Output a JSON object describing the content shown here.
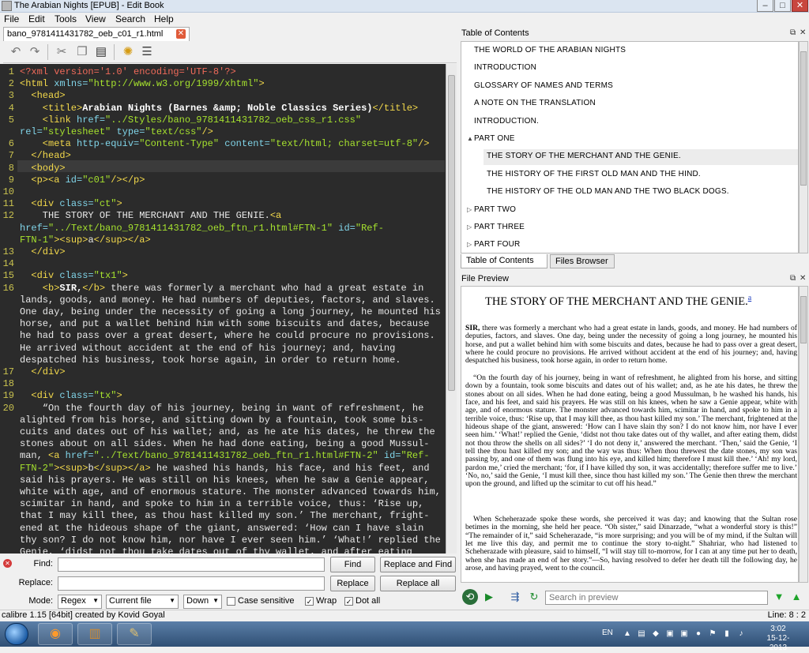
{
  "window": {
    "title": "The Arabian Nights [EPUB] - Edit Book"
  },
  "menu": [
    "File",
    "Edit",
    "Tools",
    "View",
    "Search",
    "Help"
  ],
  "editor": {
    "tab_label": "bano_9781411431782_oeb_c01_r1.html",
    "current_line": 8,
    "lines": [
      {
        "n": "1",
        "parts": [
          [
            "pi",
            "<?xml version='1.0' encoding='UTF-8'?>"
          ]
        ]
      },
      {
        "n": "2",
        "parts": [
          [
            "tag",
            "<html "
          ],
          [
            "at",
            "xmlns="
          ],
          [
            "sv",
            "\"http://www.w3.org/1999/xhtml\""
          ],
          [
            "tag",
            ">"
          ]
        ]
      },
      {
        "n": "3",
        "parts": [
          [
            "tag",
            "  <head>"
          ]
        ]
      },
      {
        "n": "4",
        "parts": [
          [
            "tag",
            "    <title>"
          ],
          [
            "bo",
            "Arabian Nights (Barnes &amp; Noble Classics Series)"
          ],
          [
            "tag",
            "</title>"
          ]
        ]
      },
      {
        "n": "5",
        "parts": [
          [
            "tag",
            "    <link "
          ],
          [
            "at",
            "href="
          ],
          [
            "sv",
            "\"../Styles/bano_9781411431782_oeb_css_r1.css\""
          ]
        ]
      },
      {
        "n": "",
        "parts": [
          [
            "at",
            "rel="
          ],
          [
            "sv",
            "\"stylesheet\" "
          ],
          [
            "at",
            "type="
          ],
          [
            "sv",
            "\"text/css\""
          ],
          [
            "tag",
            "/>"
          ]
        ]
      },
      {
        "n": "6",
        "parts": [
          [
            "tag",
            "    <meta "
          ],
          [
            "at",
            "http-equiv="
          ],
          [
            "sv",
            "\"Content-Type\" "
          ],
          [
            "at",
            "content="
          ],
          [
            "sv",
            "\"text/html; charset=utf-8\""
          ],
          [
            "tag",
            "/>"
          ]
        ]
      },
      {
        "n": "7",
        "parts": [
          [
            "tag",
            "  </head>"
          ]
        ]
      },
      {
        "n": "8",
        "parts": [
          [
            "tag",
            "  <body>"
          ]
        ]
      },
      {
        "n": "9",
        "parts": [
          [
            "tag",
            "  <p><a "
          ],
          [
            "at",
            "id="
          ],
          [
            "sv",
            "\"c01\""
          ],
          [
            "tag",
            "/></p>"
          ]
        ]
      },
      {
        "n": "10",
        "parts": [
          [
            "t",
            ""
          ]
        ]
      },
      {
        "n": "11",
        "parts": [
          [
            "tag",
            "  <div "
          ],
          [
            "at",
            "class="
          ],
          [
            "sv",
            "\"ct\""
          ],
          [
            "tag",
            ">"
          ]
        ]
      },
      {
        "n": "12",
        "parts": [
          [
            "t",
            "    THE STORY OF THE MERCHANT AND THE GENIE."
          ],
          [
            "tag",
            "<a"
          ]
        ]
      },
      {
        "n": "",
        "parts": [
          [
            "at",
            "href="
          ],
          [
            "sv",
            "\"../Text/bano_9781411431782_oeb_ftn_r1.html#FTN-1\" "
          ],
          [
            "at",
            "id="
          ],
          [
            "sv",
            "\"Ref-"
          ]
        ]
      },
      {
        "n": "",
        "parts": [
          [
            "sv",
            "FTN-1\""
          ],
          [
            "tag",
            "><sup>"
          ],
          [
            "t",
            "a"
          ],
          [
            "tag",
            "</sup></a>"
          ]
        ]
      },
      {
        "n": "13",
        "parts": [
          [
            "tag",
            "  </div>"
          ]
        ]
      },
      {
        "n": "14",
        "parts": [
          [
            "t",
            ""
          ]
        ]
      },
      {
        "n": "15",
        "parts": [
          [
            "tag",
            "  <div "
          ],
          [
            "at",
            "class="
          ],
          [
            "sv",
            "\"tx1\""
          ],
          [
            "tag",
            ">"
          ]
        ]
      },
      {
        "n": "16",
        "parts": [
          [
            "tag",
            "    <b>"
          ],
          [
            "bo",
            "SIR,"
          ],
          [
            "tag",
            "</b>"
          ],
          [
            "t",
            " there was formerly a merchant who had a great estate in"
          ]
        ]
      },
      {
        "n": "",
        "parts": [
          [
            "t",
            "lands, goods, and money. He had numbers of deputies, factors, and slaves."
          ]
        ]
      },
      {
        "n": "",
        "parts": [
          [
            "t",
            "One day, being under the necessity of going a long journey, he mounted his"
          ]
        ]
      },
      {
        "n": "",
        "parts": [
          [
            "t",
            "horse, and put a wallet behind him with some biscuits and dates, because"
          ]
        ]
      },
      {
        "n": "",
        "parts": [
          [
            "t",
            "he had to pass over a great desert, where he could procure no provisions."
          ]
        ]
      },
      {
        "n": "",
        "parts": [
          [
            "t",
            "He arrived without accident at the end of his journey; and, having"
          ]
        ]
      },
      {
        "n": "",
        "parts": [
          [
            "t",
            "despatched his business, took horse again, in order to return home."
          ]
        ]
      },
      {
        "n": "17",
        "parts": [
          [
            "tag",
            "  </div>"
          ]
        ]
      },
      {
        "n": "18",
        "parts": [
          [
            "t",
            ""
          ]
        ]
      },
      {
        "n": "19",
        "parts": [
          [
            "tag",
            "  <div "
          ],
          [
            "at",
            "class="
          ],
          [
            "sv",
            "\"tx\""
          ],
          [
            "tag",
            ">"
          ]
        ]
      },
      {
        "n": "20",
        "parts": [
          [
            "t",
            "    “On the fourth day of his journey, being in want of refreshment, he"
          ]
        ]
      },
      {
        "n": "",
        "parts": [
          [
            "t",
            "alighted from his horse, and sitting down by a fountain, took some bis-"
          ]
        ]
      },
      {
        "n": "",
        "parts": [
          [
            "t",
            "cuits and dates out of his wallet; and, as he ate his dates, he threw the"
          ]
        ]
      },
      {
        "n": "",
        "parts": [
          [
            "t",
            "stones about on all sides. When he had done eating, being a good Mussul-"
          ]
        ]
      },
      {
        "n": "",
        "parts": [
          [
            "t",
            "man, "
          ],
          [
            "tag",
            "<a "
          ],
          [
            "at",
            "href="
          ],
          [
            "sv",
            "\"../Text/bano_9781411431782_oeb_ftn_r1.html#FTN-2\" "
          ],
          [
            "at",
            "id="
          ],
          [
            "sv",
            "\"Ref-"
          ]
        ]
      },
      {
        "n": "",
        "parts": [
          [
            "sv",
            "FTN-2\""
          ],
          [
            "tag",
            "><sup>"
          ],
          [
            "t",
            "b"
          ],
          [
            "tag",
            "</sup></a>"
          ],
          [
            "t",
            " he washed his hands, his face, and his feet, and"
          ]
        ]
      },
      {
        "n": "",
        "parts": [
          [
            "t",
            "said his prayers. He was still on his knees, when he saw a Genie appear,"
          ]
        ]
      },
      {
        "n": "",
        "parts": [
          [
            "t",
            "white with age, and of enormous stature. The monster advanced towards him,"
          ]
        ]
      },
      {
        "n": "",
        "parts": [
          [
            "t",
            "scimitar in hand, and spoke to him in a terrible voice, thus: ‘Rise up,"
          ]
        ]
      },
      {
        "n": "",
        "parts": [
          [
            "t",
            "that I may kill thee, as thou hast killed my son.’ The merchant, fright-"
          ]
        ]
      },
      {
        "n": "",
        "parts": [
          [
            "t",
            "ened at the hideous shape of the giant, answered: ‘How can I have slain"
          ]
        ]
      },
      {
        "n": "",
        "parts": [
          [
            "t",
            "thy son? I do not know him, nor have I ever seen him.’ ‘What!’ replied the"
          ]
        ]
      },
      {
        "n": "",
        "parts": [
          [
            "t",
            "Genie, ‘didst not thou take dates out of thy wallet, and after eating"
          ]
        ]
      }
    ]
  },
  "find": {
    "find_label": "Find:",
    "replace_label": "Replace:",
    "mode_label": "Mode:",
    "find_value": "",
    "replace_value": "",
    "find_btn": "Find",
    "replace_and_find_btn": "Replace and Find",
    "replace_btn": "Replace",
    "replace_all_btn": "Replace all",
    "mode_value": "Regex",
    "scope_value": "Current file",
    "direction_value": "Down",
    "case_label": "Case sensitive",
    "wrap_label": "Wrap",
    "dotall_label": "Dot all",
    "case_checked": false,
    "wrap_checked": true,
    "dotall_checked": true
  },
  "status": {
    "left": "calibre 1.15 [64bit] created by Kovid Goyal",
    "right": "Line: 8 : 2"
  },
  "toc": {
    "title": "Table of Contents",
    "items": [
      {
        "label": "THE WORLD OF THE ARABIAN NIGHTS",
        "level": 0,
        "arrow": ""
      },
      {
        "label": "INTRODUCTION",
        "level": 0,
        "arrow": ""
      },
      {
        "label": "GLOSSARY OF NAMES AND TERMS",
        "level": 0,
        "arrow": ""
      },
      {
        "label": "A NOTE ON THE TRANSLATION",
        "level": 0,
        "arrow": ""
      },
      {
        "label": "INTRODUCTION.",
        "level": 0,
        "arrow": ""
      },
      {
        "label": "PART ONE",
        "level": 0,
        "arrow": "▲"
      },
      {
        "label": "THE STORY OF THE MERCHANT AND THE GENIE.",
        "level": 1,
        "arrow": "",
        "selected": true
      },
      {
        "label": "THE HISTORY OF THE FIRST OLD MAN AND THE HIND.",
        "level": 1,
        "arrow": ""
      },
      {
        "label": "THE HISTORY OF THE OLD MAN AND THE TWO BLACK DOGS.",
        "level": 1,
        "arrow": ""
      },
      {
        "label": "PART TWO",
        "level": 0,
        "arrow": "▷"
      },
      {
        "label": "PART THREE",
        "level": 0,
        "arrow": "▷"
      },
      {
        "label": "PART FOUR",
        "level": 0,
        "arrow": "▷"
      }
    ],
    "tabs": [
      "Table of Contents",
      "Files Browser"
    ]
  },
  "preview": {
    "title": "File Preview",
    "heading": "THE STORY OF THE MERCHANT AND THE GENIE.",
    "heading_sup": "a",
    "search_placeholder": "Search in preview",
    "para1_bold": "SIR,",
    "para1": " there was formerly a merchant who had a great estate in lands, goods, and money. He had numbers of deputies, factors, and slaves. One day, being under the necessity of going a long journey, he mounted his horse, and put a wallet behind him with some biscuits and dates, because he had to pass over a great desert, where he could procure no provisions. He arrived without accident at the end of his journey; and, having despatched his business, took horse again, in order to return home.",
    "para2": "“On the fourth day of his journey, being in want of refreshment, he alighted from his horse, and sitting down by a fountain, took some biscuits and dates out of his wallet; and, as he ate his dates, he threw the stones about on all sides. When he had done eating, being a good Mussulman, b he washed his hands, his face, and his feet, and said his prayers. He was still on his knees, when he saw a Genie appear, white with age, and of enormous stature. The monster advanced towards him, scimitar in hand, and spoke to him in a terrible voice, thus: ‘Rise up, that I may kill thee, as thou hast killed my son.’ The merchant, frightened at the hideous shape of the giant, answered: ‘How can I have slain thy son? I do not know him, nor have I ever seen him.’ ‘What!’ replied the Genie, ‘didst not thou take dates out of thy wallet, and after eating them, didst not thou throw the shells on all sides?’ ‘I do not deny it,’ answered the merchant. ‘Then,’ said the Genie, ‘I tell thee thou hast killed my son; and the way was thus: When thou threwest the date stones, my son was passing by, and one of them was flung into his eye, and killed him; therefore I must kill thee.’ ‘Ah! my lord, pardon me,’ cried the merchant; ‘for, if I have killed thy son, it was accidentally; therefore suffer me to live.’ ‘No, no,’ said the Genie, ‘I must kill thee, since thou hast killed my son.’ The Genie then threw the merchant upon the ground, and lifted up the scimitar to cut off his head.”",
    "para3": "When Scheherazade spoke these words, she perceived it was day; and knowing that the Sultan rose betimes in the morning, she held her peace. “Oh sister,” said Dinarzade, “what a wonderful story is this!” “The remainder of it,” said Scheherazade, “is more surprising; and you will be of my mind, if the Sultan will let me live this day, and permit me to continue the story to-night.” Shahriar, who had listened to Scheherazade with pleasure, said to himself, “I will stay till to-morrow, for I can at any time put her to death, when she has made an end of her story.”—So, having resolved to defer her death till the following day, he arose, and having prayed, went to the council."
  },
  "taskbar": {
    "lang": "EN",
    "time": "3:02",
    "date": "15-12-2013"
  }
}
